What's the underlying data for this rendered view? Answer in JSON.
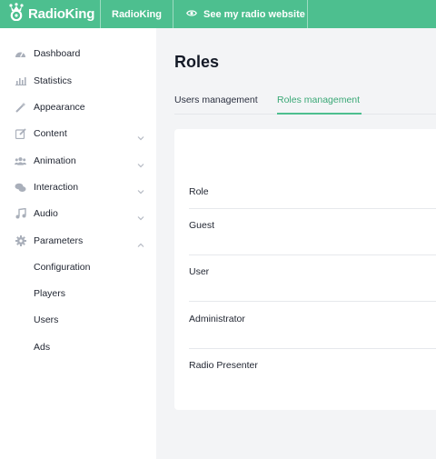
{
  "topbar": {
    "logo_text": "RadioKing",
    "station_name": "RadioKing",
    "website_link": "See my radio website"
  },
  "sidebar": {
    "items": [
      {
        "label": "Dashboard",
        "icon": "dashboard-icon"
      },
      {
        "label": "Statistics",
        "icon": "chart-icon"
      },
      {
        "label": "Appearance",
        "icon": "wand-icon"
      },
      {
        "label": "Content",
        "icon": "edit-icon",
        "expandable": true
      },
      {
        "label": "Animation",
        "icon": "users-icon",
        "expandable": true
      },
      {
        "label": "Interaction",
        "icon": "chat-icon",
        "expandable": true
      },
      {
        "label": "Audio",
        "icon": "music-icon",
        "expandable": true
      },
      {
        "label": "Parameters",
        "icon": "gear-icon",
        "expandable": true,
        "expanded": true
      }
    ],
    "sub_items": [
      "Configuration",
      "Players",
      "Users",
      "Ads"
    ]
  },
  "main": {
    "title": "Roles",
    "tabs": [
      {
        "label": "Users management",
        "active": false
      },
      {
        "label": "Roles management",
        "active": true
      }
    ],
    "table": {
      "column_header": "Role",
      "rows": [
        "Guest",
        "User",
        "Administrator",
        "Radio Presenter"
      ]
    }
  },
  "colors": {
    "accent": "#4dbf8f",
    "accent_text": "#3aa876",
    "sidebar_icon": "#a9afba"
  }
}
